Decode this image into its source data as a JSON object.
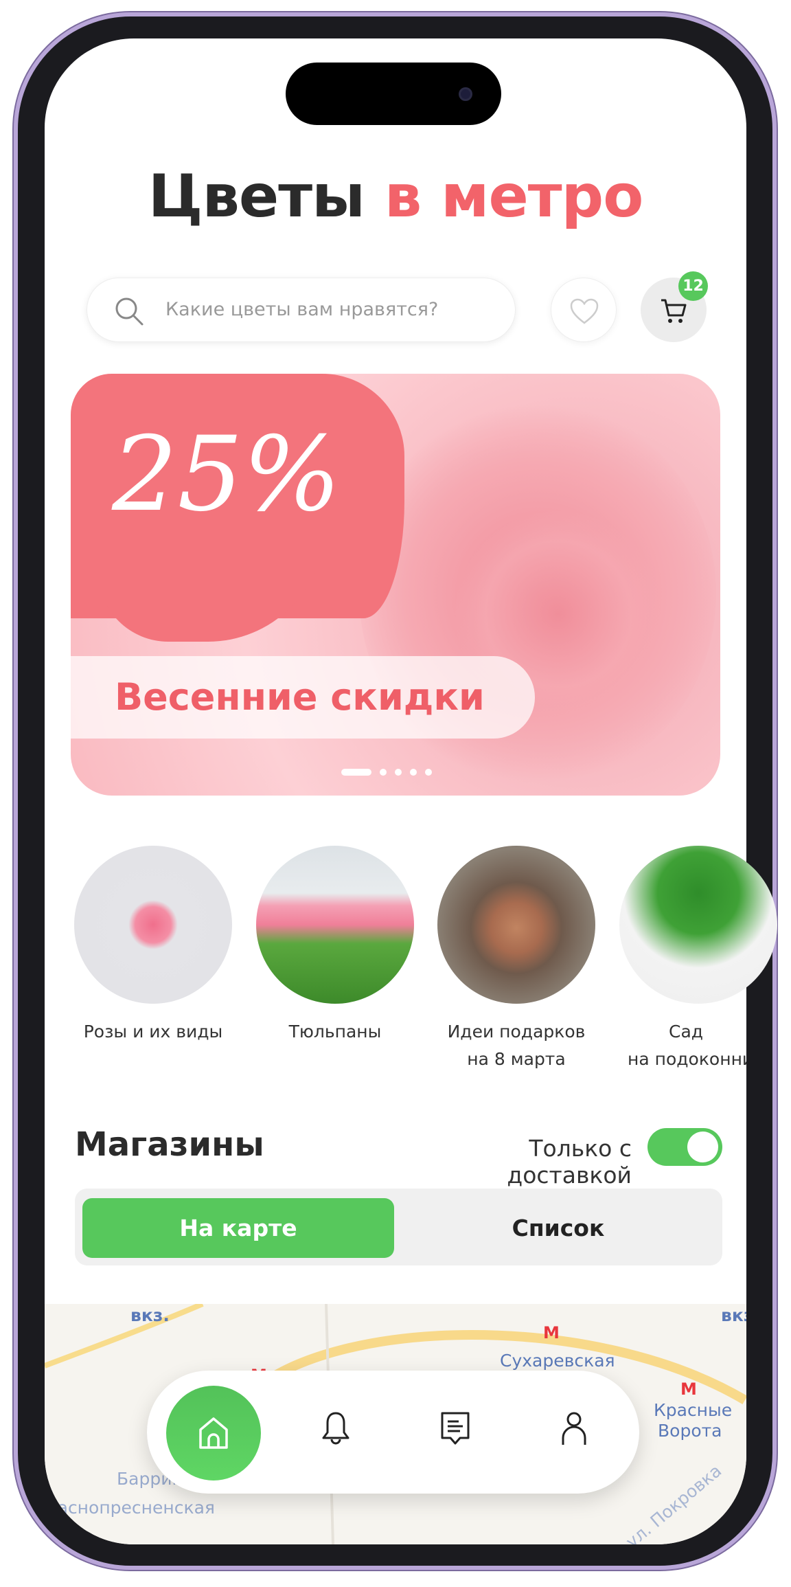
{
  "header": {
    "title_main": "Цветы",
    "title_accent": "в метро"
  },
  "search": {
    "placeholder": "Какие цветы вам нравятся?"
  },
  "cart": {
    "badge_count": "12"
  },
  "banner": {
    "discount": "25%",
    "caption": "Весенние скидки",
    "slides": 5,
    "active_slide": 1
  },
  "categories": [
    {
      "label": "Розы и их виды"
    },
    {
      "label": "Тюльпаны"
    },
    {
      "label_line1": "Идеи подарков",
      "label_line2": "на 8 марта"
    },
    {
      "label_line1": "Сад",
      "label_line2": "на подоконнике"
    }
  ],
  "shops": {
    "title": "Магазины",
    "delivery_label": "Только с доставкой",
    "delivery_on": true,
    "tabs": [
      {
        "label": "На карте",
        "active": true
      },
      {
        "label": "Список",
        "active": false
      }
    ]
  },
  "map": {
    "labels": [
      "вкз.",
      "Сухаревская",
      "Красные",
      "Ворота",
      "Баррикадная",
      "Краснопресненская",
      "ул. Покровка",
      "вкз."
    ],
    "metro_symbol": "М"
  },
  "nav": {
    "items": [
      "home-icon",
      "bell-icon",
      "chat-icon",
      "user-icon"
    ],
    "active": "home-icon"
  },
  "colors": {
    "accent": "#f2636a",
    "green": "#57c85c"
  }
}
